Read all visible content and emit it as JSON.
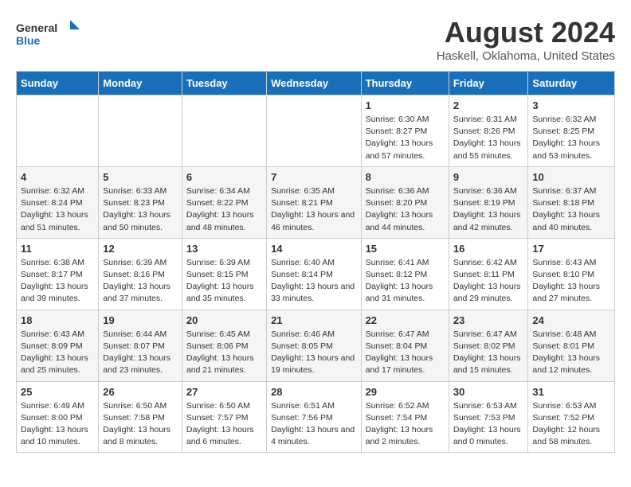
{
  "logo": {
    "line1": "General",
    "line2": "Blue"
  },
  "title": "August 2024",
  "location": "Haskell, Oklahoma, United States",
  "weekdays": [
    "Sunday",
    "Monday",
    "Tuesday",
    "Wednesday",
    "Thursday",
    "Friday",
    "Saturday"
  ],
  "weeks": [
    [
      {
        "day": "",
        "sunrise": "",
        "sunset": "",
        "daylight": ""
      },
      {
        "day": "",
        "sunrise": "",
        "sunset": "",
        "daylight": ""
      },
      {
        "day": "",
        "sunrise": "",
        "sunset": "",
        "daylight": ""
      },
      {
        "day": "",
        "sunrise": "",
        "sunset": "",
        "daylight": ""
      },
      {
        "day": "1",
        "sunrise": "Sunrise: 6:30 AM",
        "sunset": "Sunset: 8:27 PM",
        "daylight": "Daylight: 13 hours and 57 minutes."
      },
      {
        "day": "2",
        "sunrise": "Sunrise: 6:31 AM",
        "sunset": "Sunset: 8:26 PM",
        "daylight": "Daylight: 13 hours and 55 minutes."
      },
      {
        "day": "3",
        "sunrise": "Sunrise: 6:32 AM",
        "sunset": "Sunset: 8:25 PM",
        "daylight": "Daylight: 13 hours and 53 minutes."
      }
    ],
    [
      {
        "day": "4",
        "sunrise": "Sunrise: 6:32 AM",
        "sunset": "Sunset: 8:24 PM",
        "daylight": "Daylight: 13 hours and 51 minutes."
      },
      {
        "day": "5",
        "sunrise": "Sunrise: 6:33 AM",
        "sunset": "Sunset: 8:23 PM",
        "daylight": "Daylight: 13 hours and 50 minutes."
      },
      {
        "day": "6",
        "sunrise": "Sunrise: 6:34 AM",
        "sunset": "Sunset: 8:22 PM",
        "daylight": "Daylight: 13 hours and 48 minutes."
      },
      {
        "day": "7",
        "sunrise": "Sunrise: 6:35 AM",
        "sunset": "Sunset: 8:21 PM",
        "daylight": "Daylight: 13 hours and 46 minutes."
      },
      {
        "day": "8",
        "sunrise": "Sunrise: 6:36 AM",
        "sunset": "Sunset: 8:20 PM",
        "daylight": "Daylight: 13 hours and 44 minutes."
      },
      {
        "day": "9",
        "sunrise": "Sunrise: 6:36 AM",
        "sunset": "Sunset: 8:19 PM",
        "daylight": "Daylight: 13 hours and 42 minutes."
      },
      {
        "day": "10",
        "sunrise": "Sunrise: 6:37 AM",
        "sunset": "Sunset: 8:18 PM",
        "daylight": "Daylight: 13 hours and 40 minutes."
      }
    ],
    [
      {
        "day": "11",
        "sunrise": "Sunrise: 6:38 AM",
        "sunset": "Sunset: 8:17 PM",
        "daylight": "Daylight: 13 hours and 39 minutes."
      },
      {
        "day": "12",
        "sunrise": "Sunrise: 6:39 AM",
        "sunset": "Sunset: 8:16 PM",
        "daylight": "Daylight: 13 hours and 37 minutes."
      },
      {
        "day": "13",
        "sunrise": "Sunrise: 6:39 AM",
        "sunset": "Sunset: 8:15 PM",
        "daylight": "Daylight: 13 hours and 35 minutes."
      },
      {
        "day": "14",
        "sunrise": "Sunrise: 6:40 AM",
        "sunset": "Sunset: 8:14 PM",
        "daylight": "Daylight: 13 hours and 33 minutes."
      },
      {
        "day": "15",
        "sunrise": "Sunrise: 6:41 AM",
        "sunset": "Sunset: 8:12 PM",
        "daylight": "Daylight: 13 hours and 31 minutes."
      },
      {
        "day": "16",
        "sunrise": "Sunrise: 6:42 AM",
        "sunset": "Sunset: 8:11 PM",
        "daylight": "Daylight: 13 hours and 29 minutes."
      },
      {
        "day": "17",
        "sunrise": "Sunrise: 6:43 AM",
        "sunset": "Sunset: 8:10 PM",
        "daylight": "Daylight: 13 hours and 27 minutes."
      }
    ],
    [
      {
        "day": "18",
        "sunrise": "Sunrise: 6:43 AM",
        "sunset": "Sunset: 8:09 PM",
        "daylight": "Daylight: 13 hours and 25 minutes."
      },
      {
        "day": "19",
        "sunrise": "Sunrise: 6:44 AM",
        "sunset": "Sunset: 8:07 PM",
        "daylight": "Daylight: 13 hours and 23 minutes."
      },
      {
        "day": "20",
        "sunrise": "Sunrise: 6:45 AM",
        "sunset": "Sunset: 8:06 PM",
        "daylight": "Daylight: 13 hours and 21 minutes."
      },
      {
        "day": "21",
        "sunrise": "Sunrise: 6:46 AM",
        "sunset": "Sunset: 8:05 PM",
        "daylight": "Daylight: 13 hours and 19 minutes."
      },
      {
        "day": "22",
        "sunrise": "Sunrise: 6:47 AM",
        "sunset": "Sunset: 8:04 PM",
        "daylight": "Daylight: 13 hours and 17 minutes."
      },
      {
        "day": "23",
        "sunrise": "Sunrise: 6:47 AM",
        "sunset": "Sunset: 8:02 PM",
        "daylight": "Daylight: 13 hours and 15 minutes."
      },
      {
        "day": "24",
        "sunrise": "Sunrise: 6:48 AM",
        "sunset": "Sunset: 8:01 PM",
        "daylight": "Daylight: 13 hours and 12 minutes."
      }
    ],
    [
      {
        "day": "25",
        "sunrise": "Sunrise: 6:49 AM",
        "sunset": "Sunset: 8:00 PM",
        "daylight": "Daylight: 13 hours and 10 minutes."
      },
      {
        "day": "26",
        "sunrise": "Sunrise: 6:50 AM",
        "sunset": "Sunset: 7:58 PM",
        "daylight": "Daylight: 13 hours and 8 minutes."
      },
      {
        "day": "27",
        "sunrise": "Sunrise: 6:50 AM",
        "sunset": "Sunset: 7:57 PM",
        "daylight": "Daylight: 13 hours and 6 minutes."
      },
      {
        "day": "28",
        "sunrise": "Sunrise: 6:51 AM",
        "sunset": "Sunset: 7:56 PM",
        "daylight": "Daylight: 13 hours and 4 minutes."
      },
      {
        "day": "29",
        "sunrise": "Sunrise: 6:52 AM",
        "sunset": "Sunset: 7:54 PM",
        "daylight": "Daylight: 13 hours and 2 minutes."
      },
      {
        "day": "30",
        "sunrise": "Sunrise: 6:53 AM",
        "sunset": "Sunset: 7:53 PM",
        "daylight": "Daylight: 13 hours and 0 minutes."
      },
      {
        "day": "31",
        "sunrise": "Sunrise: 6:53 AM",
        "sunset": "Sunset: 7:52 PM",
        "daylight": "Daylight: 12 hours and 58 minutes."
      }
    ]
  ]
}
